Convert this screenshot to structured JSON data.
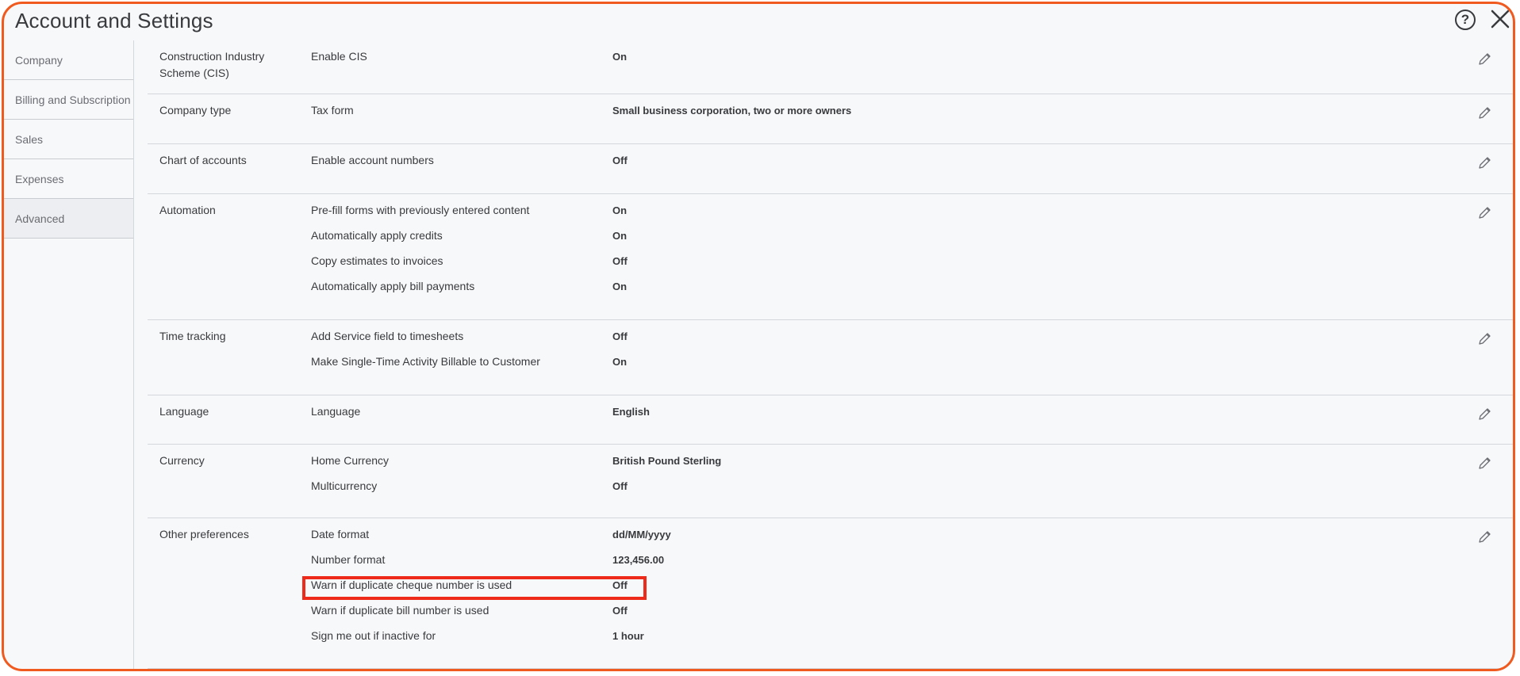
{
  "window": {
    "title": "Account and Settings"
  },
  "sidebar": {
    "items": [
      {
        "label": "Company"
      },
      {
        "label": "Billing and Subscription"
      },
      {
        "label": "Sales"
      },
      {
        "label": "Expenses"
      },
      {
        "label": "Advanced"
      }
    ]
  },
  "sections": [
    {
      "title": "Construction Industry Scheme (CIS)",
      "rows": [
        {
          "label": "Enable CIS",
          "value": "On"
        }
      ]
    },
    {
      "title": "Company type",
      "rows": [
        {
          "label": "Tax form",
          "value": "Small business corporation, two or more owners"
        }
      ]
    },
    {
      "title": "Chart of accounts",
      "rows": [
        {
          "label": "Enable account numbers",
          "value": "Off"
        }
      ]
    },
    {
      "title": "Automation",
      "rows": [
        {
          "label": "Pre-fill forms with previously entered content",
          "value": "On"
        },
        {
          "label": "Automatically apply credits",
          "value": "On"
        },
        {
          "label": "Copy estimates to invoices",
          "value": "Off"
        },
        {
          "label": "Automatically apply bill payments",
          "value": "On"
        }
      ]
    },
    {
      "title": "Time tracking",
      "rows": [
        {
          "label": "Add Service field to timesheets",
          "value": "Off"
        },
        {
          "label": "Make Single-Time Activity Billable to Customer",
          "value": "On"
        }
      ]
    },
    {
      "title": "Language",
      "rows": [
        {
          "label": "Language",
          "value": "English"
        }
      ]
    },
    {
      "title": "Currency",
      "rows": [
        {
          "label": "Home Currency",
          "value": "British Pound Sterling"
        },
        {
          "label": "Multicurrency",
          "value": "Off"
        }
      ]
    },
    {
      "title": "Other preferences",
      "rows": [
        {
          "label": "Date format",
          "value": "dd/MM/yyyy"
        },
        {
          "label": "Number format",
          "value": "123,456.00"
        },
        {
          "label": "Warn if duplicate cheque number is used",
          "value": "Off"
        },
        {
          "label": "Warn if duplicate bill number is used",
          "value": "Off"
        },
        {
          "label": "Sign me out if inactive for",
          "value": "1 hour"
        }
      ]
    }
  ],
  "colors": {
    "accent_border": "#f05a1f",
    "highlight": "#ee2a1b",
    "text": "#393a3d"
  }
}
